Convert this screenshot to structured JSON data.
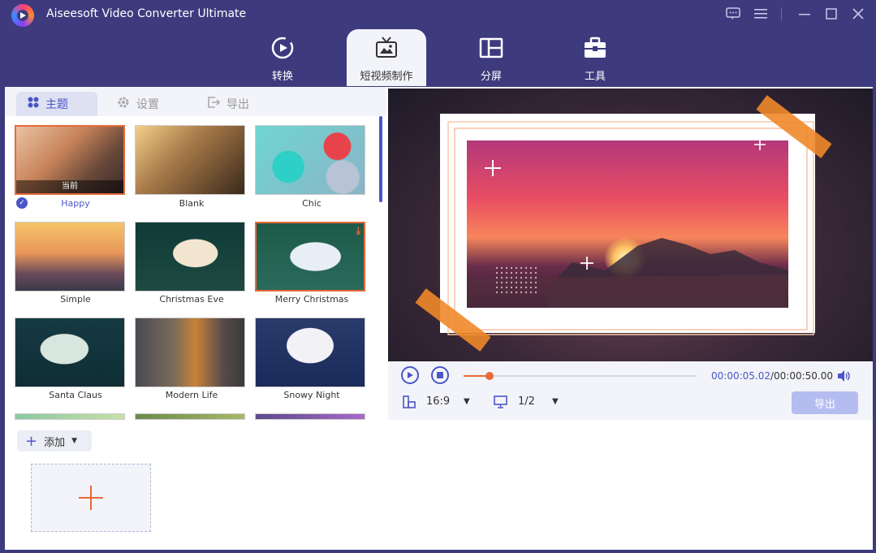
{
  "app": {
    "title": "Aiseesoft Video Converter Ultimate"
  },
  "nav_tabs": [
    {
      "label": "转换",
      "icon": "convert-icon"
    },
    {
      "label": "短视频制作",
      "icon": "tv-icon",
      "active": true
    },
    {
      "label": "分屏",
      "icon": "split-screen-icon"
    },
    {
      "label": "工具",
      "icon": "toolbox-icon"
    }
  ],
  "subtabs": [
    {
      "label": "主题",
      "icon": "grid-icon",
      "active": true
    },
    {
      "label": "设置",
      "icon": "gear-icon"
    },
    {
      "label": "导出",
      "icon": "export-icon"
    }
  ],
  "themes": [
    {
      "label": "Happy",
      "badge": "当前",
      "selected": true
    },
    {
      "label": "Blank"
    },
    {
      "label": "Chic"
    },
    {
      "label": "Simple"
    },
    {
      "label": "Christmas Eve"
    },
    {
      "label": "Merry Christmas",
      "download": true
    },
    {
      "label": "Santa Claus"
    },
    {
      "label": "Modern Life"
    },
    {
      "label": "Snowy Night"
    }
  ],
  "player": {
    "current_time": "00:00:05.02",
    "total_time": "/00:00:50.00",
    "progress": 0.11,
    "aspect_ratio": "16:9",
    "scale": "1/2",
    "export_label": "导出"
  },
  "bottom": {
    "add_label": "添加"
  },
  "colors": {
    "header_bg": "#3d3b7e",
    "accent": "#4a56c6",
    "highlight": "#e8693a"
  }
}
